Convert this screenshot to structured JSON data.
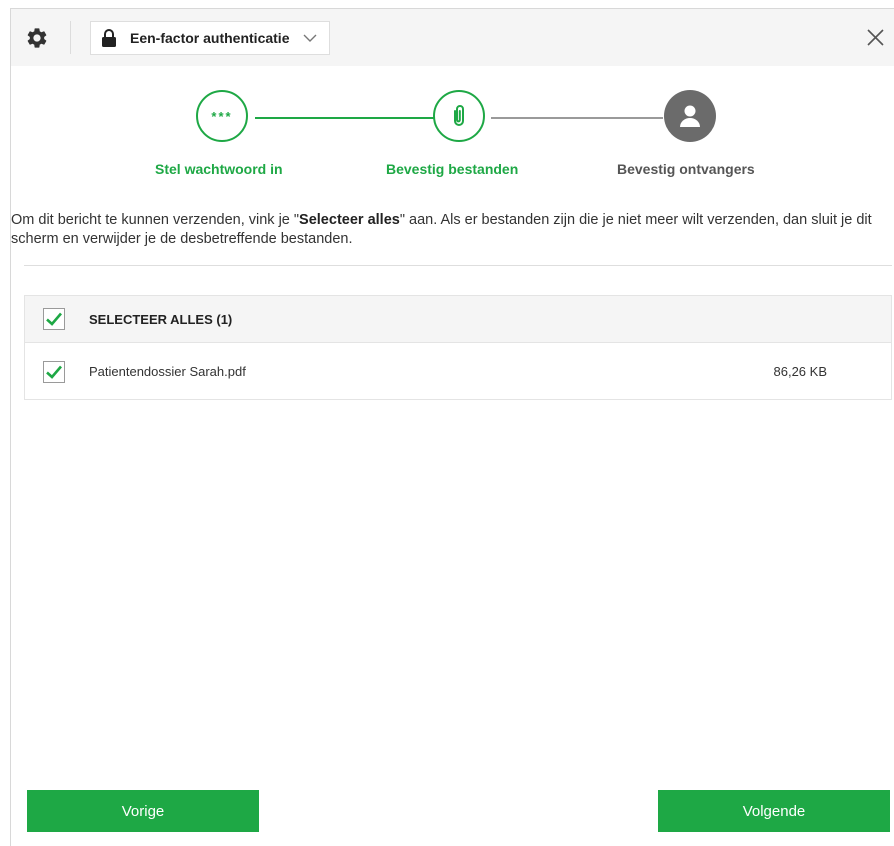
{
  "toolbar": {
    "auth_mode": "Een-factor authenticatie"
  },
  "stepper": {
    "steps": [
      {
        "label": "Stel wachtwoord in",
        "icon": "password-dots-icon",
        "symbol": "***",
        "state": "completed"
      },
      {
        "label": "Bevestig bestanden",
        "icon": "paperclip-icon",
        "state": "active"
      },
      {
        "label": "Bevestig ontvangers",
        "icon": "person-icon",
        "state": "pending"
      }
    ]
  },
  "intro": {
    "text_before": "Om dit bericht te kunnen verzenden, vink je \"",
    "bold": "Selecteer alles",
    "text_after": "\" aan. Als er bestanden zijn die je niet meer wilt verzenden, dan sluit je dit scherm en verwijder je de desbetreffende bestanden."
  },
  "file_list": {
    "select_all_label": "SELECTEER ALLES (1)",
    "select_all_checked": true,
    "files": [
      {
        "name": "Patientendossier Sarah.pdf",
        "size": "86,26 KB",
        "checked": true
      }
    ]
  },
  "buttons": {
    "previous": "Vorige",
    "next": "Volgende"
  },
  "colors": {
    "accent": "#1ea845",
    "pending": "#6b6b6b"
  }
}
